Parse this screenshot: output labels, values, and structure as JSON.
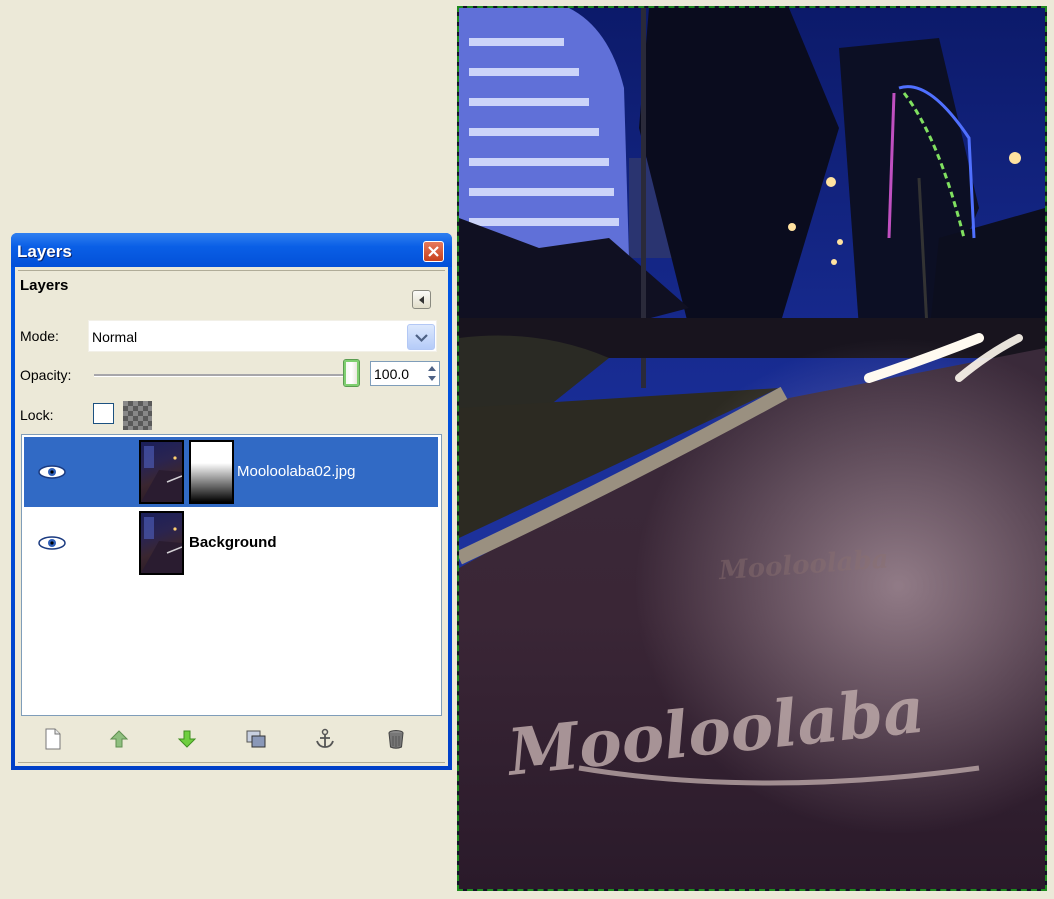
{
  "dialog": {
    "title": "Layers",
    "header": "Layers",
    "mode_label": "Mode:",
    "mode_value": "Normal",
    "opacity_label": "Opacity:",
    "opacity_value": "100.0",
    "opacity_level_percent": 100,
    "lock_label": "Lock:",
    "lock_pixels_checked": false
  },
  "layers": [
    {
      "name": "Mooloolaba02.jpg",
      "visible": true,
      "selected": true,
      "has_mask": true
    },
    {
      "name": "Background",
      "visible": true,
      "selected": false,
      "has_mask": false
    }
  ],
  "toolbar": {
    "icons": [
      "new-layer-icon",
      "raise-layer-icon",
      "lower-layer-icon",
      "duplicate-layer-icon",
      "anchor-layer-icon",
      "delete-layer-icon"
    ]
  },
  "canvas": {
    "watermark": "Mooloolaba"
  },
  "colors": {
    "selection_highlight": "#316ac5",
    "titlebar_blue": "#0a5fe6",
    "selection_marquee": "#1e8a1e"
  }
}
